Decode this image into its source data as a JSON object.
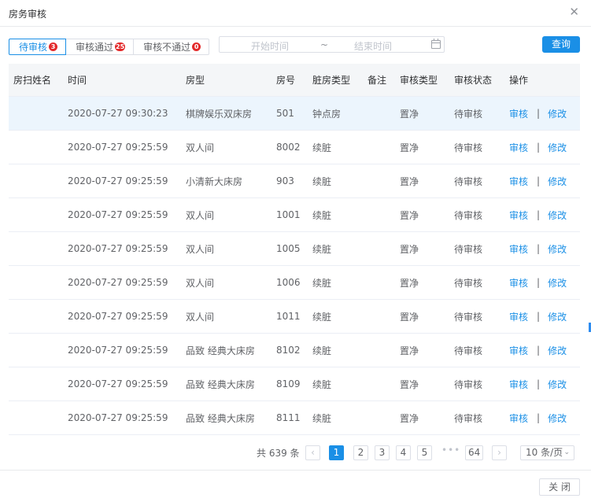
{
  "dialog": {
    "title": "房务审核",
    "close_icon": "✕"
  },
  "tabs": [
    {
      "label": "待审核",
      "badge": "3"
    },
    {
      "label": "审核通过",
      "badge": "25"
    },
    {
      "label": "审核不通过",
      "badge": "0"
    }
  ],
  "daterange": {
    "start_placeholder": "开始时间",
    "separator": "~",
    "end_placeholder": "结束时间",
    "icon": "calendar-icon"
  },
  "query_label": "查询",
  "table": {
    "columns": [
      "房扫姓名",
      "时间",
      "房型",
      "房号",
      "脏房类型",
      "备注",
      "审核类型",
      "审核状态",
      "操作"
    ],
    "rows": [
      {
        "name": "",
        "time": "2020-07-27 09:30:23",
        "room_type": "棋牌娱乐双床房",
        "room_no": "501",
        "dirty_type": "钟点房",
        "note": "",
        "audit_type": "置净",
        "audit_status": "待审核"
      },
      {
        "name": "",
        "time": "2020-07-27 09:25:59",
        "room_type": "双人间",
        "room_no": "8002",
        "dirty_type": "续脏",
        "note": "",
        "audit_type": "置净",
        "audit_status": "待审核"
      },
      {
        "name": "",
        "time": "2020-07-27 09:25:59",
        "room_type": "小清新大床房",
        "room_no": "903",
        "dirty_type": "续脏",
        "note": "",
        "audit_type": "置净",
        "audit_status": "待审核"
      },
      {
        "name": "",
        "time": "2020-07-27 09:25:59",
        "room_type": "双人间",
        "room_no": "1001",
        "dirty_type": "续脏",
        "note": "",
        "audit_type": "置净",
        "audit_status": "待审核"
      },
      {
        "name": "",
        "time": "2020-07-27 09:25:59",
        "room_type": "双人间",
        "room_no": "1005",
        "dirty_type": "续脏",
        "note": "",
        "audit_type": "置净",
        "audit_status": "待审核"
      },
      {
        "name": "",
        "time": "2020-07-27 09:25:59",
        "room_type": "双人间",
        "room_no": "1006",
        "dirty_type": "续脏",
        "note": "",
        "audit_type": "置净",
        "audit_status": "待审核"
      },
      {
        "name": "",
        "time": "2020-07-27 09:25:59",
        "room_type": "双人间",
        "room_no": "1011",
        "dirty_type": "续脏",
        "note": "",
        "audit_type": "置净",
        "audit_status": "待审核"
      },
      {
        "name": "",
        "time": "2020-07-27 09:25:59",
        "room_type": "品致 经典大床房",
        "room_no": "8102",
        "dirty_type": "续脏",
        "note": "",
        "audit_type": "置净",
        "audit_status": "待审核"
      },
      {
        "name": "",
        "time": "2020-07-27 09:25:59",
        "room_type": "品致 经典大床房",
        "room_no": "8109",
        "dirty_type": "续脏",
        "note": "",
        "audit_type": "置净",
        "audit_status": "待审核"
      },
      {
        "name": "",
        "time": "2020-07-27 09:25:59",
        "room_type": "品致 经典大床房",
        "room_no": "8111",
        "dirty_type": "续脏",
        "note": "",
        "audit_type": "置净",
        "audit_status": "待审核"
      }
    ],
    "action_audit": "审核",
    "action_sep": "|",
    "action_edit": "修改"
  },
  "pagination": {
    "total_text": "共 639 条",
    "prev_icon": "‹",
    "next_icon": "›",
    "pages": [
      "1",
      "2",
      "3",
      "4",
      "5"
    ],
    "current_page": "1",
    "ellipsis": "•••",
    "last_page": "64",
    "page_size": "10 条/页",
    "page_size_icon": "⌄"
  },
  "footer": {
    "close_label": "关 闭"
  },
  "colors": {
    "accent": "#1a8fe6",
    "badge": "#e3292a",
    "row_highlight": "#ecf5fd"
  }
}
